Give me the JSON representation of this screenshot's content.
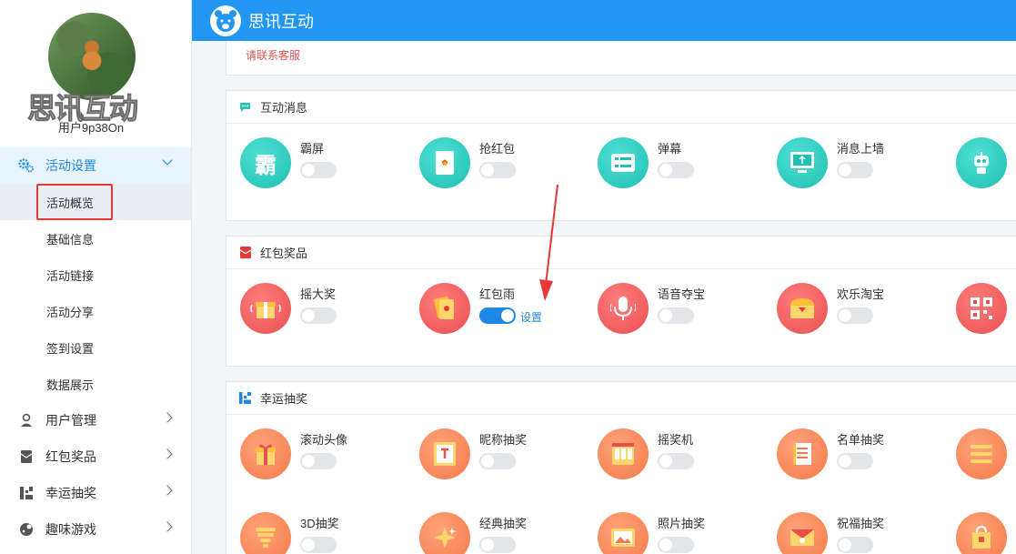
{
  "app": {
    "title": "思讯互动",
    "brand_watermark": "思讯互动"
  },
  "user": {
    "name": "用户9p38On"
  },
  "sidebar": {
    "groups": [
      {
        "label": "活动设置",
        "icon": "gear-icon",
        "expanded": true,
        "children": [
          {
            "label": "活动概览",
            "selected": true
          },
          {
            "label": "基础信息"
          },
          {
            "label": "活动链接"
          },
          {
            "label": "活动分享"
          },
          {
            "label": "签到设置"
          },
          {
            "label": "数据展示"
          }
        ]
      },
      {
        "label": "用户管理",
        "icon": "user-icon"
      },
      {
        "label": "红包奖品",
        "icon": "red-packet-icon"
      },
      {
        "label": "幸运抽奖",
        "icon": "lottery-icon"
      },
      {
        "label": "趣味游戏",
        "icon": "game-icon"
      }
    ]
  },
  "top_panel": {
    "notice": "请联系客服"
  },
  "sections": [
    {
      "title": "互动消息",
      "icon": "chat-icon",
      "features": [
        {
          "label": "霸屏",
          "icon": "ba-screen-icon",
          "glyph": "霸",
          "enabled": false
        },
        {
          "label": "抢红包",
          "icon": "red-envelope-icon",
          "enabled": false
        },
        {
          "label": "弹幕",
          "icon": "bullet-comment-icon",
          "enabled": false
        },
        {
          "label": "消息上墙",
          "icon": "monitor-upload-icon",
          "enabled": false
        },
        {
          "icon": "robot-icon"
        }
      ]
    },
    {
      "title": "红包奖品",
      "icon": "red-packet-icon",
      "features": [
        {
          "label": "摇大奖",
          "icon": "shake-gift-icon",
          "enabled": false
        },
        {
          "label": "红包雨",
          "icon": "red-packet-rain-icon",
          "enabled": true,
          "setting_label": "设置"
        },
        {
          "label": "语音夺宝",
          "icon": "microphone-icon",
          "enabled": false
        },
        {
          "label": "欢乐淘宝",
          "icon": "treasure-chest-icon",
          "enabled": false
        },
        {
          "icon": "qr-code-icon"
        }
      ]
    },
    {
      "title": "幸运抽奖",
      "icon": "lottery-icon",
      "features": [
        {
          "label": "滚动头像",
          "icon": "gift-box-icon",
          "enabled": false
        },
        {
          "label": "昵称抽奖",
          "icon": "nickname-card-icon",
          "enabled": false
        },
        {
          "label": "摇奖机",
          "icon": "slot-machine-icon",
          "enabled": false
        },
        {
          "label": "名单抽奖",
          "icon": "list-icon",
          "enabled": false
        },
        {
          "icon": "menu-list-icon"
        },
        {
          "label": "3D抽奖",
          "icon": "3d-cone-icon",
          "enabled": false
        },
        {
          "label": "经典抽奖",
          "icon": "sparkle-icon",
          "enabled": false
        },
        {
          "label": "照片抽奖",
          "icon": "photo-icon",
          "enabled": false
        },
        {
          "label": "祝福抽奖",
          "icon": "envelope-icon",
          "enabled": false
        },
        {
          "icon": "gift-bag-icon"
        }
      ]
    }
  ],
  "colors": {
    "header": "#2196f3",
    "accent": "#1e88e5",
    "highlight_box": "#e53935",
    "annotation_arrow": "#e53935"
  }
}
